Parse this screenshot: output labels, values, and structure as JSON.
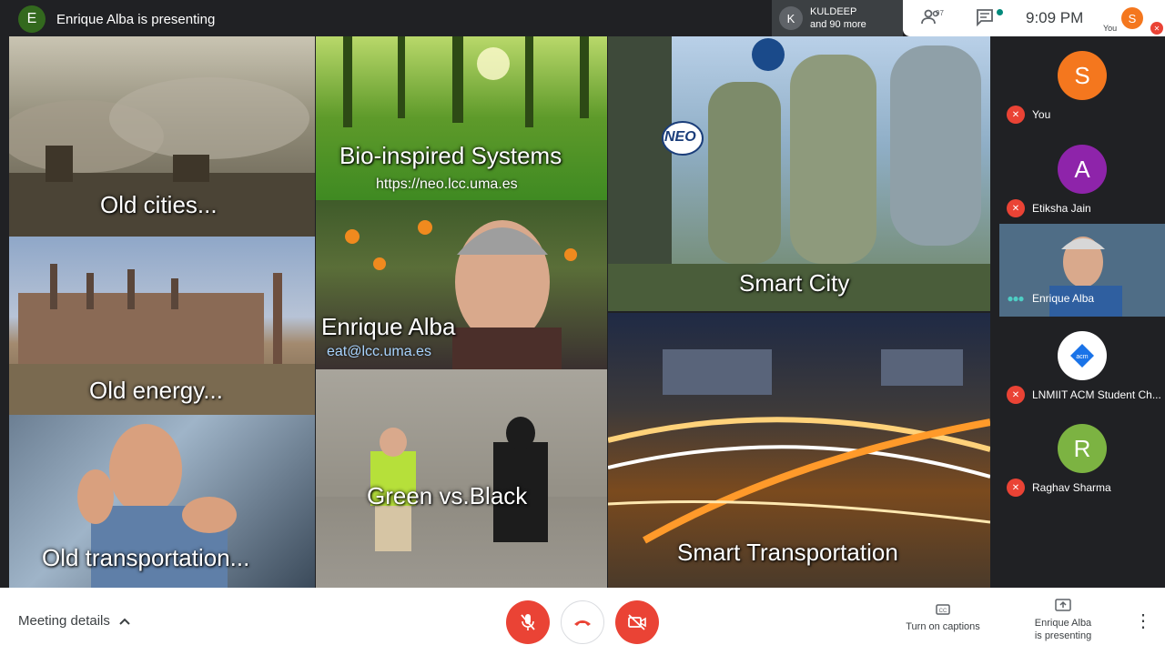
{
  "topbar": {
    "presenter_initial": "E",
    "presenter_title": "Enrique Alba is presenting",
    "chip_initial": "K",
    "chip_name": "KULDEEP",
    "chip_more": "and 90 more",
    "participant_count": "97",
    "time": "9:09 PM",
    "you_initial": "S",
    "you_label": "You"
  },
  "slides": {
    "old_cities": "Old cities...",
    "bio_title": "Bio-inspired Systems",
    "bio_url": "https://neo.lcc.uma.es",
    "smart_city": "Smart City",
    "neo_logo": "NEO",
    "old_energy": "Old energy...",
    "enrique_name": "Enrique Alba",
    "enrique_email": "eat@lcc.uma.es",
    "old_transport": "Old transportation...",
    "green_black": "Green vs.Black",
    "smart_transport": "Smart Transportation"
  },
  "participants": [
    {
      "initial": "S",
      "name": "You",
      "color": "#f4771e"
    },
    {
      "initial": "A",
      "name": "Etiksha Jain",
      "color": "#8e24aa"
    },
    {
      "initial": "",
      "name": "Enrique Alba",
      "color": "#3d5a72"
    },
    {
      "initial": "",
      "name": "LNMIIT ACM Student Ch...",
      "color": "#ffffff"
    },
    {
      "initial": "R",
      "name": "Raghav Sharma",
      "color": "#7cb342"
    }
  ],
  "bottombar": {
    "meeting_details": "Meeting details",
    "captions": "Turn on captions",
    "presenting_line1": "Enrique Alba",
    "presenting_line2": "is presenting"
  }
}
